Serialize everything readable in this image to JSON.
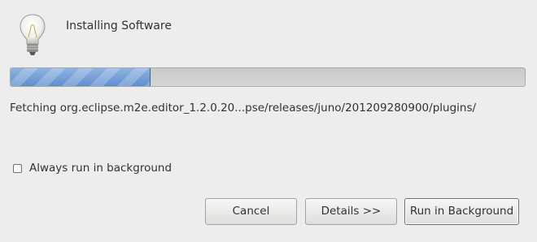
{
  "window": {
    "title": "Installing Software",
    "icon": "lightbulb-icon"
  },
  "progress": {
    "fraction": 0.27
  },
  "status": {
    "text": "Fetching org.eclipse.m2e.editor_1.2.0.20...pse/releases/juno/201209280900/plugins/"
  },
  "options": {
    "background_checkbox_label": "Always run in background",
    "background_checkbox_checked": false
  },
  "buttons": {
    "cancel": "Cancel",
    "details": "Details >>",
    "run_in_background": "Run in Background"
  }
}
